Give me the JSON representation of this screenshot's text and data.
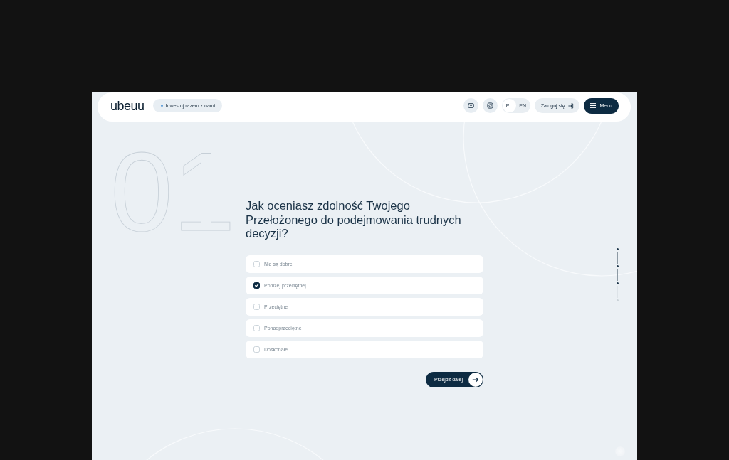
{
  "header": {
    "logo": "ubeuu",
    "invest_link": "Inwestuj razem z nami",
    "languages": [
      {
        "label": "PL",
        "selected": true
      },
      {
        "label": "EN",
        "selected": false
      }
    ],
    "login_button": "Zaloguj się",
    "menu_button": "Menu"
  },
  "step_number": "01",
  "question": {
    "text": "Jak oceniasz zdolność Twojego Przełożonego do podejmowania trudnych decyzji?",
    "options": [
      {
        "label": "Nie są dobre",
        "checked": false
      },
      {
        "label": "Poniżej przeciętnej",
        "checked": true
      },
      {
        "label": "Przeciętne",
        "checked": false
      },
      {
        "label": "Ponadprzeciętne",
        "checked": false
      },
      {
        "label": "Doskonałe",
        "checked": false
      }
    ]
  },
  "next_button": "Przejdź dalej",
  "step_indicator": [
    {
      "reached": true
    },
    {
      "reached": true
    },
    {
      "reached": true
    },
    {
      "reached": false
    }
  ]
}
